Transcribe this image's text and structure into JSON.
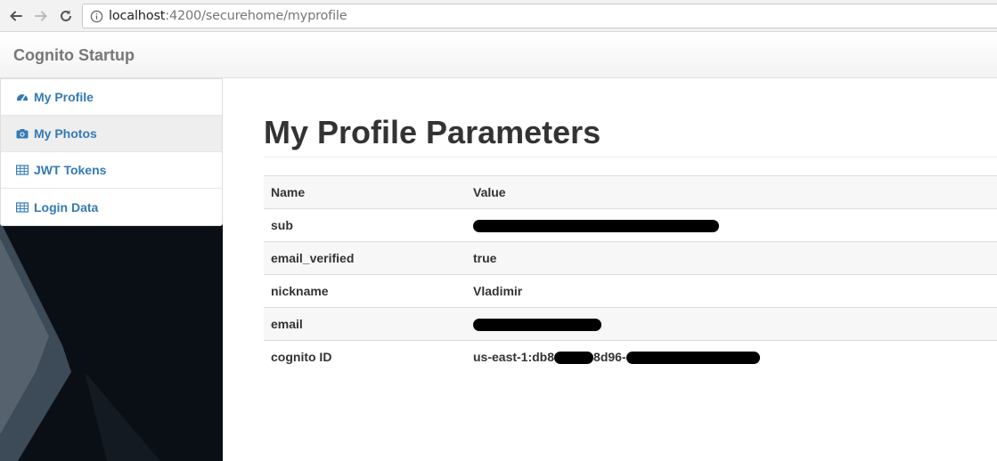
{
  "browser": {
    "url_host": "localhost",
    "url_path": ":4200/securehome/myprofile"
  },
  "navbar": {
    "brand": "Cognito Startup"
  },
  "sidebar": {
    "items": [
      {
        "label": "My Profile",
        "icon": "dashboard-icon"
      },
      {
        "label": "My Photos",
        "icon": "camera-icon",
        "active": true
      },
      {
        "label": "JWT Tokens",
        "icon": "table-icon"
      },
      {
        "label": "Login Data",
        "icon": "table-icon"
      }
    ]
  },
  "main": {
    "title": "My Profile Parameters",
    "table": {
      "headers": [
        "Name",
        "Value"
      ],
      "rows": [
        {
          "name": "sub",
          "value": ""
        },
        {
          "name": "email_verified",
          "value": "true"
        },
        {
          "name": "nickname",
          "value": "Vladimir"
        },
        {
          "name": "email",
          "value": ""
        },
        {
          "name": "cognito ID",
          "value_prefix": "us-east-1:db8",
          "value_mid": "8d96-"
        }
      ]
    }
  }
}
